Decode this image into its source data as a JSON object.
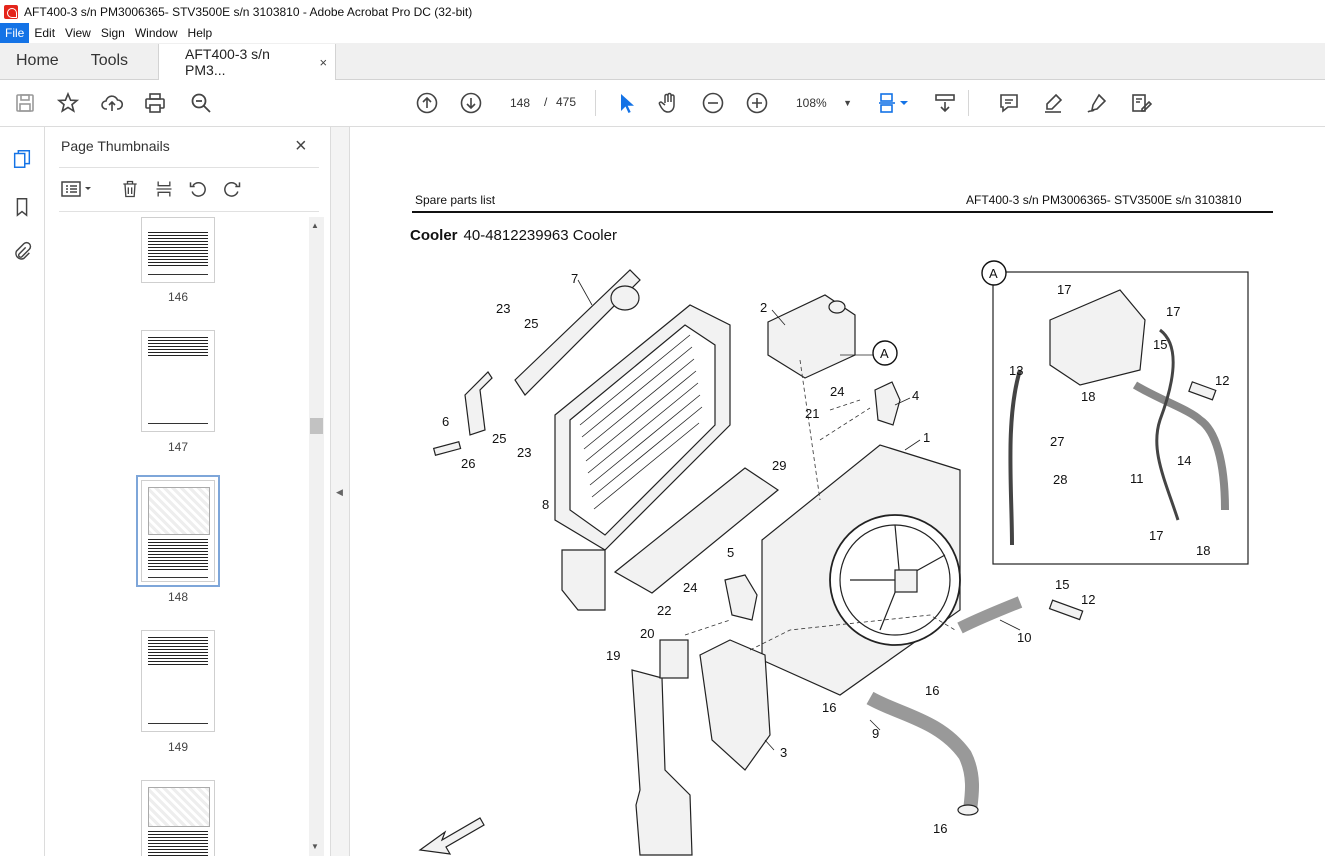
{
  "window": {
    "title": "AFT400-3 s/n PM3006365- STV3500E s/n 3103810 - Adobe Acrobat Pro DC (32-bit)"
  },
  "menubar": {
    "items": [
      "File",
      "Edit",
      "View",
      "Sign",
      "Window",
      "Help"
    ]
  },
  "tabs": {
    "home": "Home",
    "tools": "Tools",
    "document": "AFT400-3 s/n PM3...",
    "close": "×"
  },
  "toolbar": {
    "current_page": "148",
    "separator": "/",
    "total_pages": "475",
    "zoom": "108%"
  },
  "thumbnail_panel": {
    "title": "Page Thumbnails",
    "close": "×",
    "thumbnails": [
      {
        "label": "146"
      },
      {
        "label": "147"
      },
      {
        "label": "148",
        "selected": true
      },
      {
        "label": "149"
      }
    ]
  },
  "document": {
    "header_left": "Spare parts list",
    "header_right": "AFT400-3 s/n PM3006365- STV3500E s/n 3103810",
    "title_bold": "Cooler",
    "title_rest": "40-4812239963 Cooler",
    "callouts": [
      "1",
      "2",
      "3",
      "4",
      "5",
      "6",
      "7",
      "8",
      "9",
      "10",
      "11",
      "12",
      "13",
      "14",
      "15",
      "16",
      "17",
      "18",
      "19",
      "20",
      "21",
      "22",
      "23",
      "24",
      "25",
      "26",
      "27",
      "28",
      "29",
      "A"
    ]
  },
  "colors": {
    "accent": "#1473e6",
    "pdf_red": "#e4251b",
    "select_arrow": "#1473e6"
  }
}
